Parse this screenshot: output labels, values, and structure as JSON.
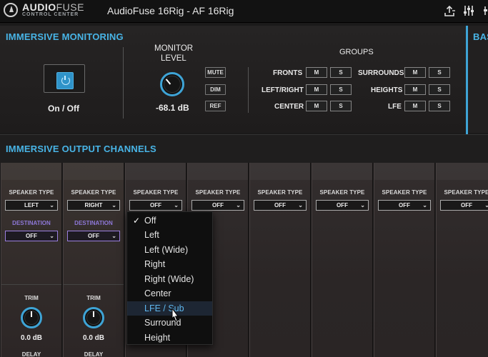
{
  "app": {
    "logo_main_bold": "AUDIO",
    "logo_main_thin": "FUSE",
    "logo_sub": "CONTROL CENTER",
    "rig_title": "AudioFuse 16Rig - AF 16Rig"
  },
  "toolbar": {
    "icons": [
      "upload-icon",
      "mixer-sliders-icon",
      "more-icon"
    ]
  },
  "monitoring": {
    "title": "IMMERSIVE MONITORING",
    "side_title": "BAS",
    "power_label": "On / Off",
    "monitor_level_label_line1": "MONITOR",
    "monitor_level_label_line2": "LEVEL",
    "monitor_level_value": "-68.1 dB",
    "mute_label": "MUTE",
    "dim_label": "DIM",
    "ref_label": "REF",
    "groups_title": "GROUPS",
    "groups_left": [
      {
        "name": "FRONTS",
        "m": "M",
        "s": "S"
      },
      {
        "name": "LEFT/RIGHT",
        "m": "M",
        "s": "S"
      },
      {
        "name": "CENTER",
        "m": "M",
        "s": "S"
      }
    ],
    "groups_right": [
      {
        "name": "SURROUNDS",
        "m": "M",
        "s": "S"
      },
      {
        "name": "HEIGHTS",
        "m": "M",
        "s": "S"
      },
      {
        "name": "LFE",
        "m": "M",
        "s": "S"
      }
    ]
  },
  "output": {
    "title": "IMMERSIVE OUTPUT CHANNELS",
    "speaker_type_label": "SPEAKER TYPE",
    "destination_label": "DESTINATION",
    "trim_label": "TRIM",
    "delay_label": "DELAY",
    "channels": [
      {
        "speaker_type": "LEFT",
        "destination": "OFF",
        "trim": "0.0 dB"
      },
      {
        "speaker_type": "RIGHT",
        "destination": "OFF",
        "trim": "0.0 dB"
      },
      {
        "speaker_type": "OFF"
      },
      {
        "speaker_type": "OFF"
      },
      {
        "speaker_type": "OFF"
      },
      {
        "speaker_type": "OFF"
      },
      {
        "speaker_type": "OFF"
      },
      {
        "speaker_type": "OFF"
      }
    ]
  },
  "dropdown": {
    "selected": "Off",
    "hovered": "LFE / Sub",
    "options": [
      "Off",
      "Left",
      "Left (Wide)",
      "Right",
      "Right (Wide)",
      "Center",
      "LFE / Sub",
      "Surround",
      "Height"
    ]
  },
  "colors": {
    "accent": "#48b4e6",
    "destination": "#8e78d8",
    "hover_bg": "#1d2633"
  }
}
